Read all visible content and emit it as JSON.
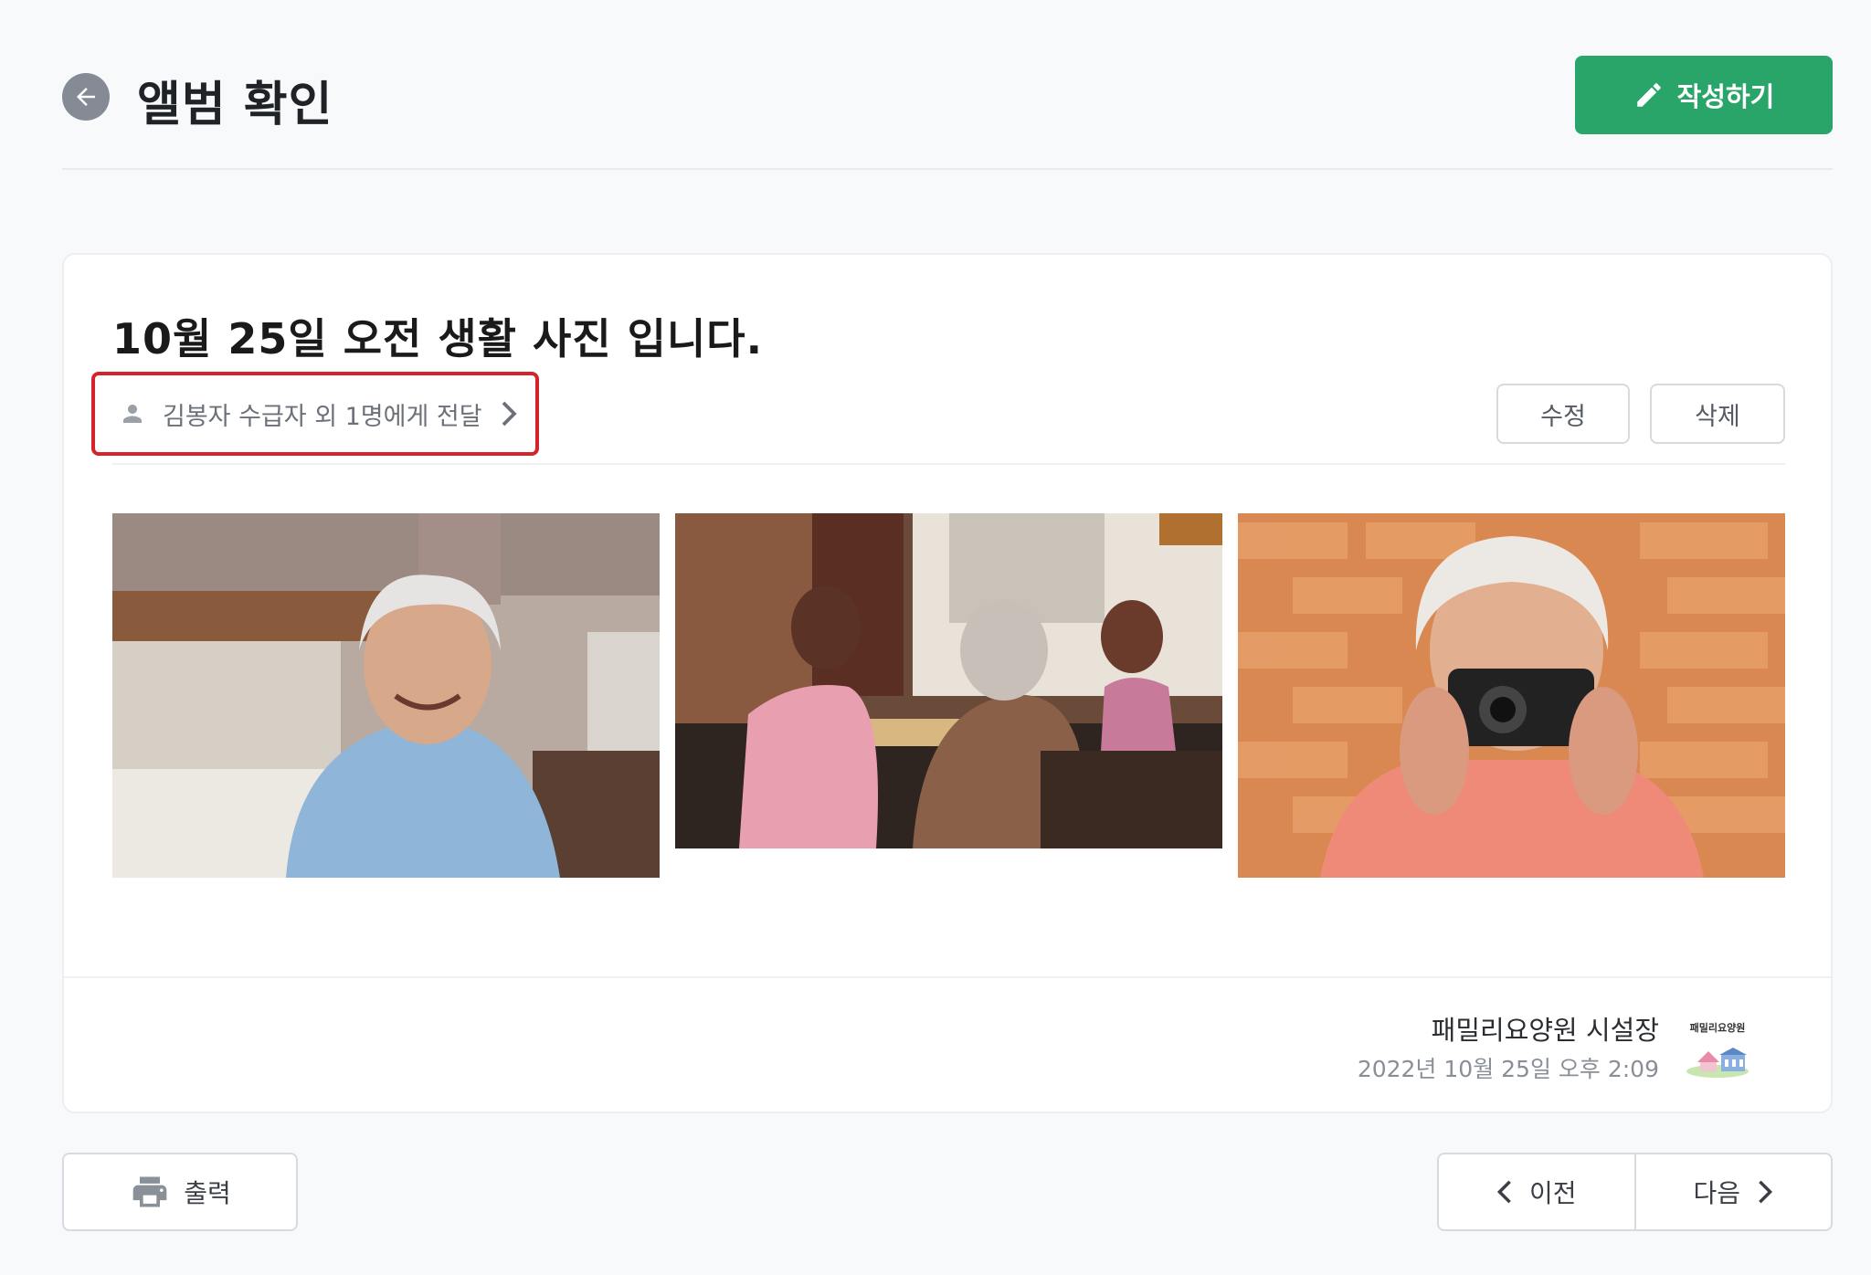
{
  "header": {
    "title": "앨범 확인",
    "write_label": "작성하기"
  },
  "post": {
    "title": "10월 25일 오전 생활 사진 입니다.",
    "recipients_text": "김봉자 수급자 외 1명에게 전달",
    "edit_label": "수정",
    "delete_label": "삭제"
  },
  "author": {
    "name": "패밀리요양원 시설장",
    "date": "2022년 10월 25일 오후 2:09",
    "logo_text": "패밀리요양원"
  },
  "footer": {
    "print_label": "출력",
    "prev_label": "이전",
    "next_label": "다음"
  },
  "colors": {
    "accent": "#2aa56a",
    "highlight": "#d6222a"
  }
}
